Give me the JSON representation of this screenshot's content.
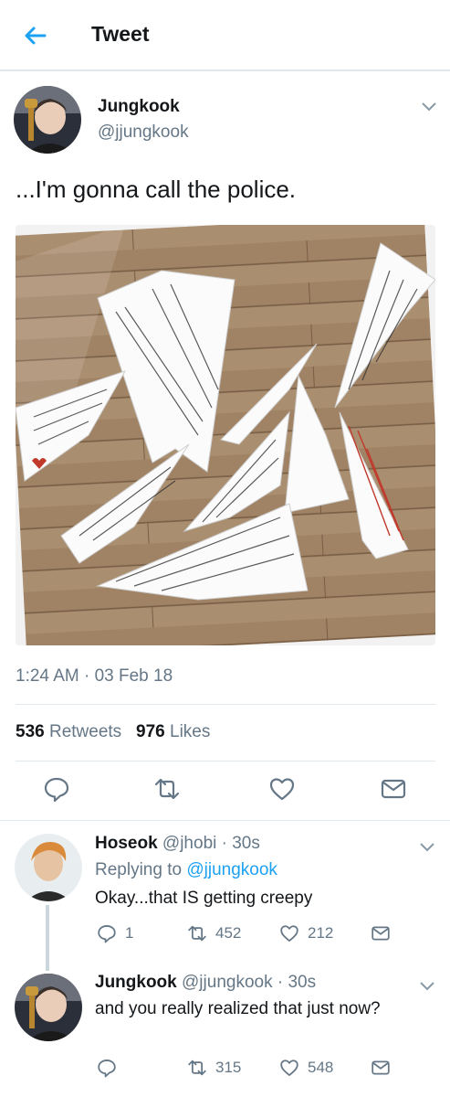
{
  "header": {
    "title": "Tweet",
    "back_icon": "arrow-left-icon"
  },
  "tweet": {
    "author_name": "Jungkook",
    "author_handle": "@jjungkook",
    "text": "...I'm gonna call the police.",
    "timestamp": "1:24 AM · 03 Feb 18",
    "retweets_count": "536",
    "retweets_label": "Retweets",
    "likes_count": "976",
    "likes_label": "Likes",
    "image_icon": "paper-airplanes-photo"
  },
  "replies": [
    {
      "name": "Hoseok",
      "meta": "@jhobi · 30s",
      "replying_prefix": "Replying to",
      "replying_to": "@jjungkook",
      "text": "Okay...that IS getting creepy",
      "reply_count": "1",
      "retweet_count": "452",
      "like_count": "212"
    },
    {
      "name": "Jungkook",
      "meta": "@jjungkook · 30s",
      "text": "and you really realized that just now?",
      "reply_count": "",
      "retweet_count": "315",
      "like_count": "548"
    }
  ],
  "colors": {
    "accent": "#1da1f2",
    "muted": "#657786",
    "text": "#14171a",
    "divider": "#e1e8ed"
  }
}
